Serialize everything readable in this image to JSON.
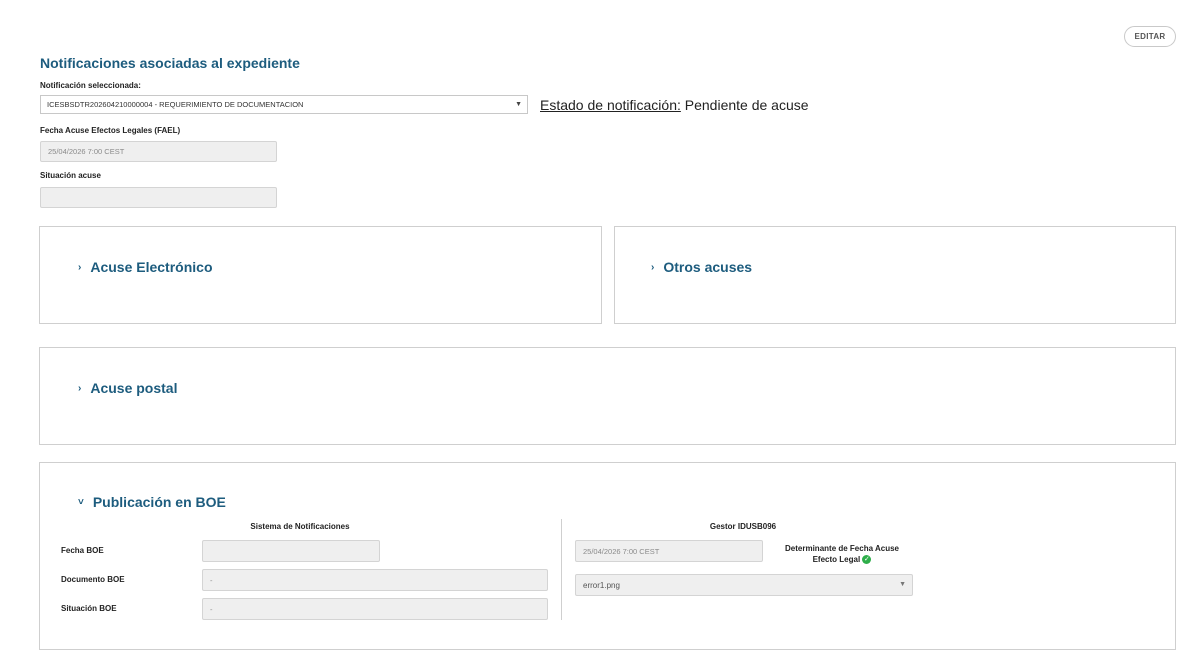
{
  "toolbar": {
    "edit_label": "EDITAR"
  },
  "title": "Notificaciones asociadas al expediente",
  "notification": {
    "label": "Notificación seleccionada:",
    "selected": "ICESBSDTR202604210000004 - REQUERIMIENTO DE DOCUMENTACION",
    "status_label": "Estado de notificación:",
    "status_value": "Pendiente de acuse"
  },
  "fael": {
    "label": "Fecha Acuse Efectos Legales (FAEL)",
    "value": "25/04/2026 7:00 CEST"
  },
  "situacion": {
    "label": "Situación acuse",
    "value": ""
  },
  "sections": {
    "electronico": "Acuse Electrónico",
    "otros": "Otros acuses",
    "postal": "Acuse postal",
    "boe": "Publicación en BOE"
  },
  "icons": {
    "collapsed": "chevron-right-icon",
    "expanded": "chevron-down-icon",
    "check": "check-circle-icon"
  },
  "boe": {
    "col_left": "Sistema de Notificaciones",
    "col_right": "Gestor IDUSB096",
    "fecha_label": "Fecha BOE",
    "fecha_value": "",
    "documento_label": "Documento BOE",
    "documento_value": "-",
    "situacion_label": "Situación BOE",
    "situacion_value": "-",
    "gestor_fecha_value": "25/04/2026 7:00 CEST",
    "determinante_line1": "Determinante de Fecha Acuse",
    "determinante_line2": "Efecto Legal",
    "file_value": "error1.png"
  },
  "colors": {
    "accent": "#1d5c7e",
    "success": "#2eae4a",
    "field_bg": "#efefef"
  }
}
